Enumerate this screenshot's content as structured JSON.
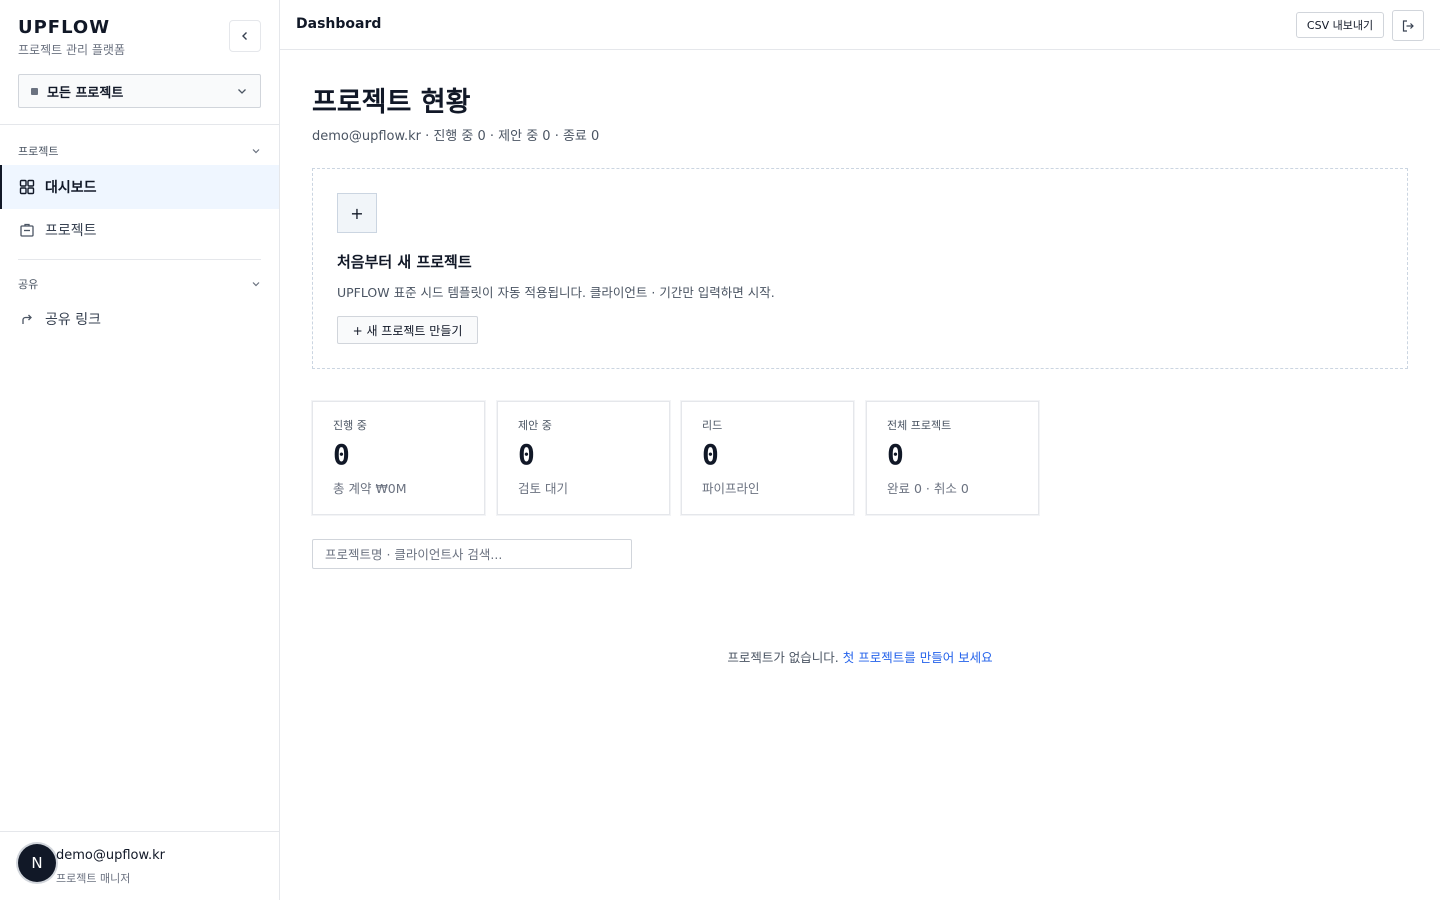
{
  "brand": {
    "title": "UPFLOW",
    "subtitle": "프로젝트 관리 플랫폼"
  },
  "project_select": {
    "value": "모든 프로젝트"
  },
  "sidebar": {
    "sections": [
      {
        "label": "프로젝트",
        "items": [
          {
            "label": "대시보드",
            "icon": "dashboard-grid-icon",
            "active": true
          },
          {
            "label": "프로젝트",
            "icon": "briefcase-icon",
            "active": false
          }
        ]
      },
      {
        "label": "공유",
        "items": [
          {
            "label": "공유 링크",
            "icon": "share-arrow-icon",
            "active": false
          }
        ]
      }
    ]
  },
  "user": {
    "avatar_initial": "N",
    "email": "demo@upflow.kr",
    "role": "프로젝트 매니저"
  },
  "header": {
    "crumb": "Dashboard",
    "csv_label": "CSV 내보내기"
  },
  "main": {
    "title": "프로젝트 현황",
    "meta": "demo@upflow.kr · 진행 중 0 · 제안 중 0 · 종료 0",
    "new_card": {
      "plus": "+",
      "title": "처음부터 새 프로젝트",
      "description": "UPFLOW 표준 시드 템플릿이 자동 적용됩니다. 클라이언트 · 기간만 입력하면 시작.",
      "button": "+ 새 프로젝트 만들기"
    },
    "stats": [
      {
        "label": "진행 중",
        "value": "0",
        "sub": "총 계약 ₩0M"
      },
      {
        "label": "제안 중",
        "value": "0",
        "sub": "검토 대기"
      },
      {
        "label": "리드",
        "value": "0",
        "sub": "파이프라인"
      },
      {
        "label": "전체 프로젝트",
        "value": "0",
        "sub": "완료 0 · 취소 0"
      }
    ],
    "search": {
      "placeholder": "프로젝트명 · 클라이언트사 검색...",
      "value": ""
    },
    "empty": {
      "text": "프로젝트가 없습니다.",
      "link": "첫 프로젝트를 만들어 보세요"
    }
  },
  "colors": {
    "accent_link": "#2563eb",
    "active_nav_bg": "#eff6ff",
    "text_primary": "#111827"
  }
}
